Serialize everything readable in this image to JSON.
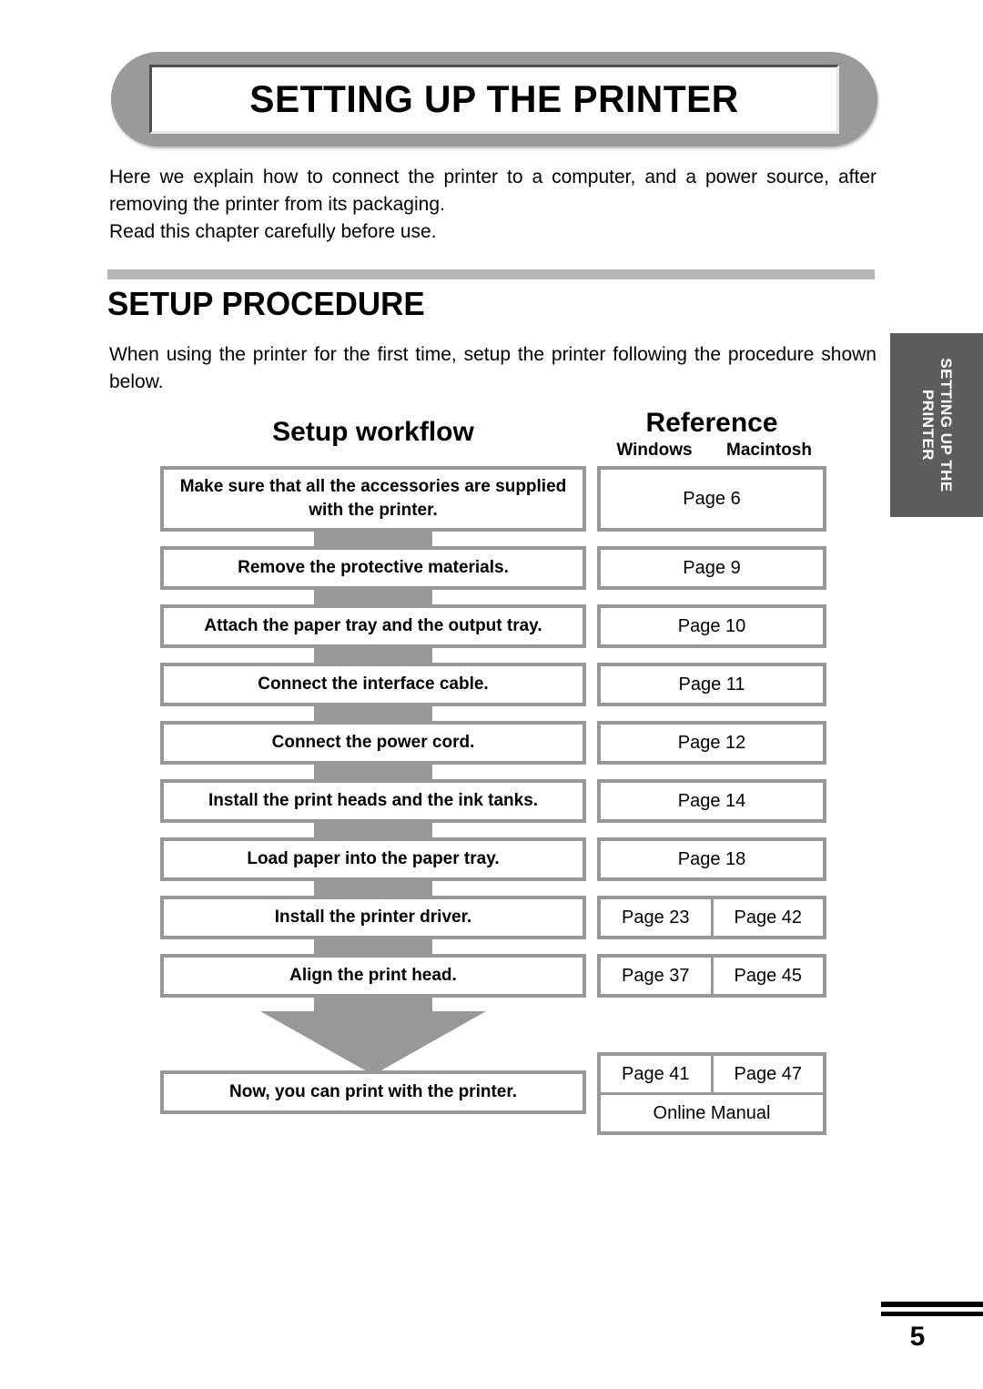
{
  "chapter": {
    "title": "SETTING UP THE PRINTER",
    "side_tab_line1": "SETTING UP THE",
    "side_tab_line2": "PRINTER"
  },
  "intro": {
    "line1": "Here we explain how to connect the printer to a computer, and a power source, after",
    "line2": "removing the printer from its packaging.",
    "line3": "Read this chapter carefully before use."
  },
  "section": {
    "heading": "SETUP PROCEDURE",
    "body_line1": "When using the printer for the first time, setup the printer following the procedure shown",
    "body_line2": "below."
  },
  "columns": {
    "workflow_title": "Setup workflow",
    "reference_title": "Reference",
    "reference_windows": "Windows",
    "reference_macintosh": "Macintosh"
  },
  "steps": [
    {
      "text": "Make sure that all the accessories are supplied with the printer.",
      "windows": "Page 6",
      "macintosh": "",
      "split": false
    },
    {
      "text": "Remove the protective materials.",
      "windows": "Page 9",
      "macintosh": "",
      "split": false
    },
    {
      "text": "Attach the paper tray and the output tray.",
      "windows": "Page 10",
      "macintosh": "",
      "split": false
    },
    {
      "text": "Connect the interface cable.",
      "windows": "Page 11",
      "macintosh": "",
      "split": false
    },
    {
      "text": "Connect the power cord.",
      "windows": "Page 12",
      "macintosh": "",
      "split": false
    },
    {
      "text": "Install the print heads and the ink tanks.",
      "windows": "Page 14",
      "macintosh": "",
      "split": false
    },
    {
      "text": "Load paper into the paper tray.",
      "windows": "Page 18",
      "macintosh": "",
      "split": false
    },
    {
      "text": "Install the printer driver.",
      "windows": "Page 23",
      "macintosh": "Page 42",
      "split": true
    },
    {
      "text": "Align the print head.",
      "windows": "Page 37",
      "macintosh": "Page 45",
      "split": true
    }
  ],
  "final_step": {
    "text": "Now, you can print with the printer.",
    "windows": "Page 41",
    "macintosh": "Page 47",
    "online_manual": "Online Manual"
  },
  "footer": {
    "page_number": "5"
  },
  "colors": {
    "plaque_gray": "#9a9a9a",
    "box_border_gray": "#989898",
    "rule_gray": "#b4b4b4",
    "side_tab_gray": "#5d5d5d"
  }
}
